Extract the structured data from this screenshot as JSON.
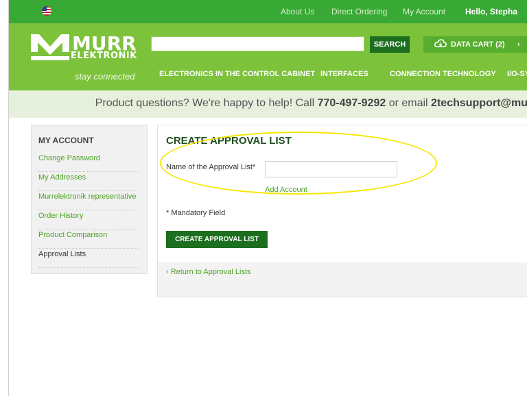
{
  "topbar": {
    "links": [
      "About Us",
      "Direct Ordering",
      "My Account"
    ],
    "greeting": "Hello, Stepha"
  },
  "header": {
    "logo": {
      "word": "MURR",
      "sub": "ELEKTRONIK",
      "tagline": "stay connected"
    },
    "search": {
      "value": "",
      "button": "SEARCH"
    },
    "datacart": {
      "label": "DATA CART (2)",
      "arrow": "›"
    },
    "nav": [
      "ELECTRONICS IN THE CONTROL CABINET",
      "INTERFACES",
      "CONNECTION TECHNOLOGY",
      "I/O-SY"
    ]
  },
  "support": {
    "prefix": "Product questions? We're happy to help! Call ",
    "phone": "770-497-9292",
    "middle": " or email ",
    "email": "2techsupport@mu"
  },
  "sidebar": {
    "title": "MY ACCOUNT",
    "items": [
      {
        "label": "Change Password"
      },
      {
        "label": "My Addresses"
      },
      {
        "label": "Murrelektronik representative"
      },
      {
        "label": "Order History"
      },
      {
        "label": "Product Comparison"
      },
      {
        "label": "Approval Lists"
      }
    ]
  },
  "main": {
    "title": "CREATE APPROVAL LIST",
    "field_label": "Name of the Approval List*",
    "field_value": "",
    "add_account": "Add Account",
    "mandatory": "* Mandatory Field",
    "create_button": "CREATE APPROVAL LIST",
    "return_link": "‹ Return to Approval Lists"
  },
  "colors": {
    "topbar": "#39a935",
    "header": "#7cc23a",
    "button": "#1c6f1e",
    "link": "#4ea325",
    "highlight": "#f6e600"
  }
}
